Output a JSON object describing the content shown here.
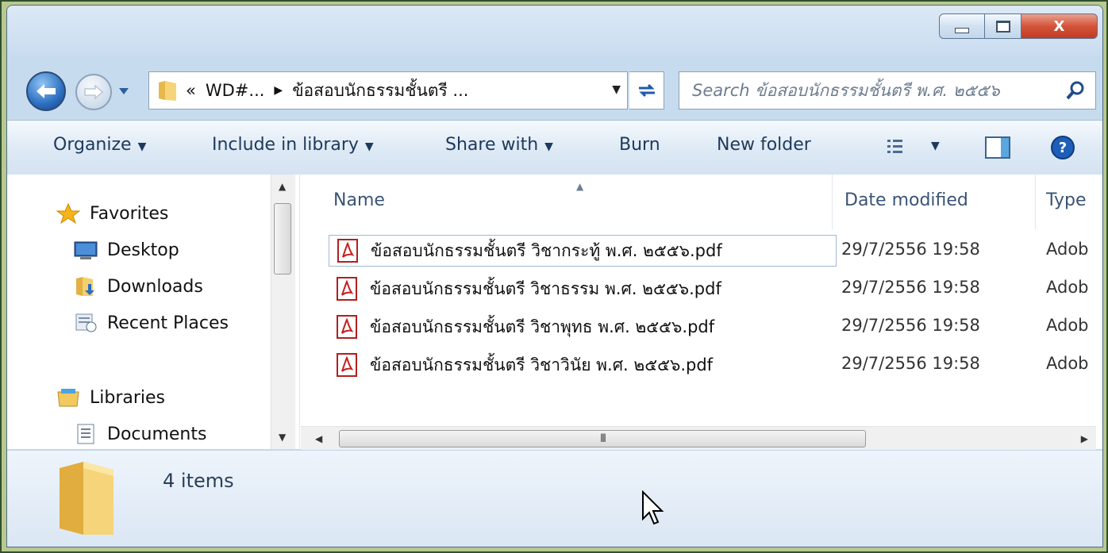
{
  "window": {
    "caption": {
      "minimize": "",
      "maximize": "",
      "close": "X"
    }
  },
  "address": {
    "overflow": "«",
    "crumb1": "WD#...",
    "crumb2": "ข้อสอบนักธรรมชั้นตรี ...",
    "search_placeholder": "Search ข้อสอบนักธรรมชั้นตรี พ.ศ. ๒๕๕๖"
  },
  "toolbar": {
    "organize": "Organize",
    "include": "Include in library",
    "share": "Share with",
    "burn": "Burn",
    "new_folder": "New folder"
  },
  "nav": {
    "favorites": "Favorites",
    "desktop": "Desktop",
    "downloads": "Downloads",
    "recent": "Recent Places",
    "libraries": "Libraries",
    "documents": "Documents"
  },
  "columns": {
    "name": "Name",
    "date": "Date modified",
    "type": "Type"
  },
  "files": [
    {
      "name": "ข้อสอบนักธรรมชั้นตรี วิชากระทู้ พ.ศ. ๒๕๕๖.pdf",
      "date": "29/7/2556 19:58",
      "type": "Adob"
    },
    {
      "name": "ข้อสอบนักธรรมชั้นตรี วิชาธรรม พ.ศ. ๒๕๕๖.pdf",
      "date": "29/7/2556 19:58",
      "type": "Adob"
    },
    {
      "name": "ข้อสอบนักธรรมชั้นตรี วิชาพุทธ พ.ศ. ๒๕๕๖.pdf",
      "date": "29/7/2556 19:58",
      "type": "Adob"
    },
    {
      "name": "ข้อสอบนักธรรมชั้นตรี วิชาวินัย พ.ศ. ๒๕๕๖.pdf",
      "date": "29/7/2556 19:58",
      "type": "Adob"
    }
  ],
  "status": {
    "count": "4 items"
  },
  "scroll": {
    "grip": "III"
  },
  "icons": {
    "back": "back-arrow-icon",
    "forward": "forward-arrow-icon",
    "folder": "folder-icon",
    "refresh": "refresh-icon",
    "search": "search-icon",
    "views": "views-icon",
    "preview": "preview-pane-icon",
    "help": "help-icon",
    "pdf": "pdf-icon"
  },
  "colors": {
    "accent": "#2d6fc0",
    "close": "#c13b22",
    "text": "#1e395b"
  }
}
